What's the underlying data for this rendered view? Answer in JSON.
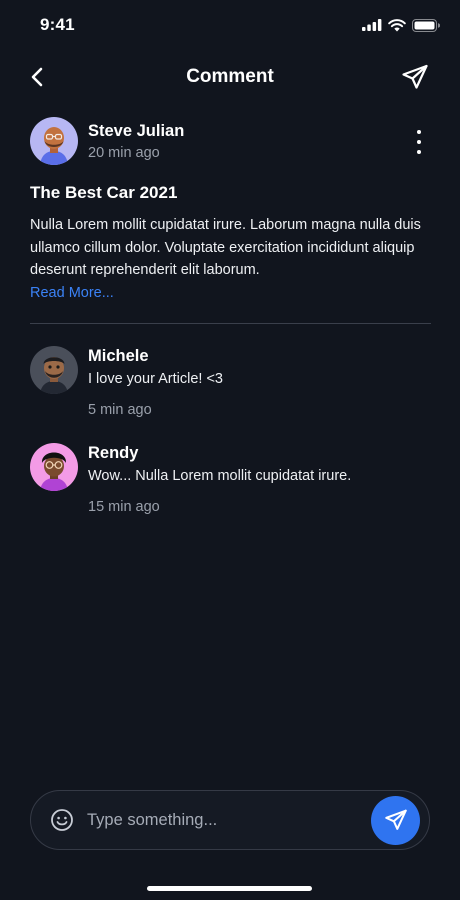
{
  "status_bar": {
    "time": "9:41"
  },
  "nav": {
    "title": "Comment"
  },
  "post": {
    "author": "Steve Julian",
    "time": "20 min ago",
    "title": "The Best Car 2021",
    "body": "Nulla Lorem mollit cupidatat irure. Laborum magna nulla duis ullamco cillum dolor. Voluptate exercitation incididunt aliquip deserunt reprehenderit elit laborum.",
    "read_more": "Read More..."
  },
  "comments": [
    {
      "author": "Michele",
      "text": "I love your Article! <3",
      "time": "5 min ago"
    },
    {
      "author": "Rendy",
      "text": "Wow... Nulla Lorem mollit cupidatat irure.",
      "time": "15 min ago"
    }
  ],
  "composer": {
    "placeholder": "Type something..."
  },
  "colors": {
    "background": "#11151e",
    "accent": "#2f74f0",
    "link": "#3b82f6",
    "muted": "#9aa0ab"
  }
}
